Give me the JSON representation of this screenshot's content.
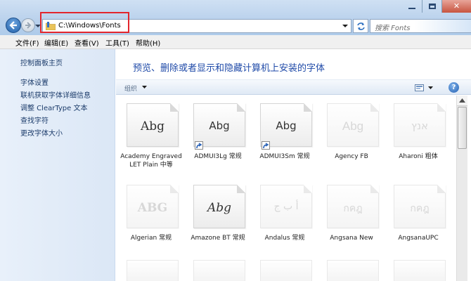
{
  "address": {
    "path": "C:\\Windows\\Fonts"
  },
  "search": {
    "placeholder": "搜索 Fonts"
  },
  "menu": [
    {
      "label": "文件(F)"
    },
    {
      "label": "编辑(E)"
    },
    {
      "label": "查看(V)"
    },
    {
      "label": "工具(T)"
    },
    {
      "label": "帮助(H)"
    }
  ],
  "sidebar": {
    "home": "控制面板主页",
    "links": [
      {
        "label": "字体设置"
      },
      {
        "label": "联机获取字体详细信息"
      },
      {
        "label": "调整 ClearType 文本"
      },
      {
        "label": "查找字符"
      },
      {
        "label": "更改字体大小"
      }
    ]
  },
  "main": {
    "title": "预览、删除或者显示和隐藏计算机上安装的字体",
    "toolbar": {
      "organize": "组织"
    }
  },
  "fonts": [
    {
      "sample": "Abg",
      "name": "Academy Engraved LET Plain 中等",
      "shortcut": false,
      "faded": false
    },
    {
      "sample": "Abg",
      "name": "ADMUI3Lg 常规",
      "shortcut": true,
      "faded": false
    },
    {
      "sample": "Abg",
      "name": "ADMUI3Sm 常规",
      "shortcut": true,
      "faded": false
    },
    {
      "sample": "Abg",
      "name": "Agency FB",
      "shortcut": false,
      "faded": true
    },
    {
      "sample": "אנץ",
      "name": "Aharoni 粗体",
      "shortcut": false,
      "faded": true
    },
    {
      "sample": "ABG",
      "name": "Algerian 常规",
      "shortcut": false,
      "faded": true
    },
    {
      "sample": "Abg",
      "name": "Amazone BT 常规",
      "shortcut": false,
      "faded": false
    },
    {
      "sample": "أ ب ج",
      "name": "Andalus 常规",
      "shortcut": false,
      "faded": true
    },
    {
      "sample": "กคฎ",
      "name": "Angsana New",
      "shortcut": false,
      "faded": true
    },
    {
      "sample": "กคฎ",
      "name": "AngsanaUPC",
      "shortcut": false,
      "faded": true
    }
  ]
}
